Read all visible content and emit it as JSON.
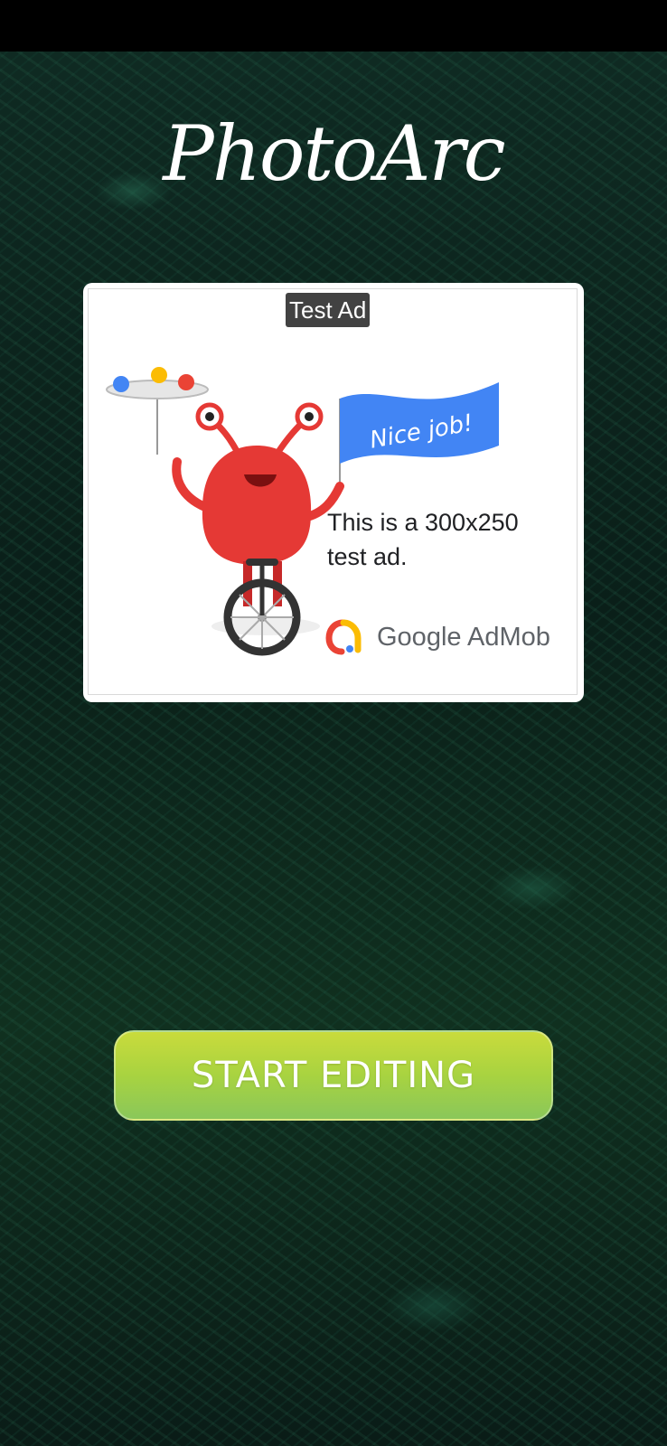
{
  "app": {
    "title": "PhotoArc"
  },
  "ad": {
    "label": "Test Ad",
    "banner_text": "Nice job!",
    "description": "This is a 300x250 test ad.",
    "brand": "Google AdMob"
  },
  "main": {
    "start_button_label": "START EDITING"
  }
}
